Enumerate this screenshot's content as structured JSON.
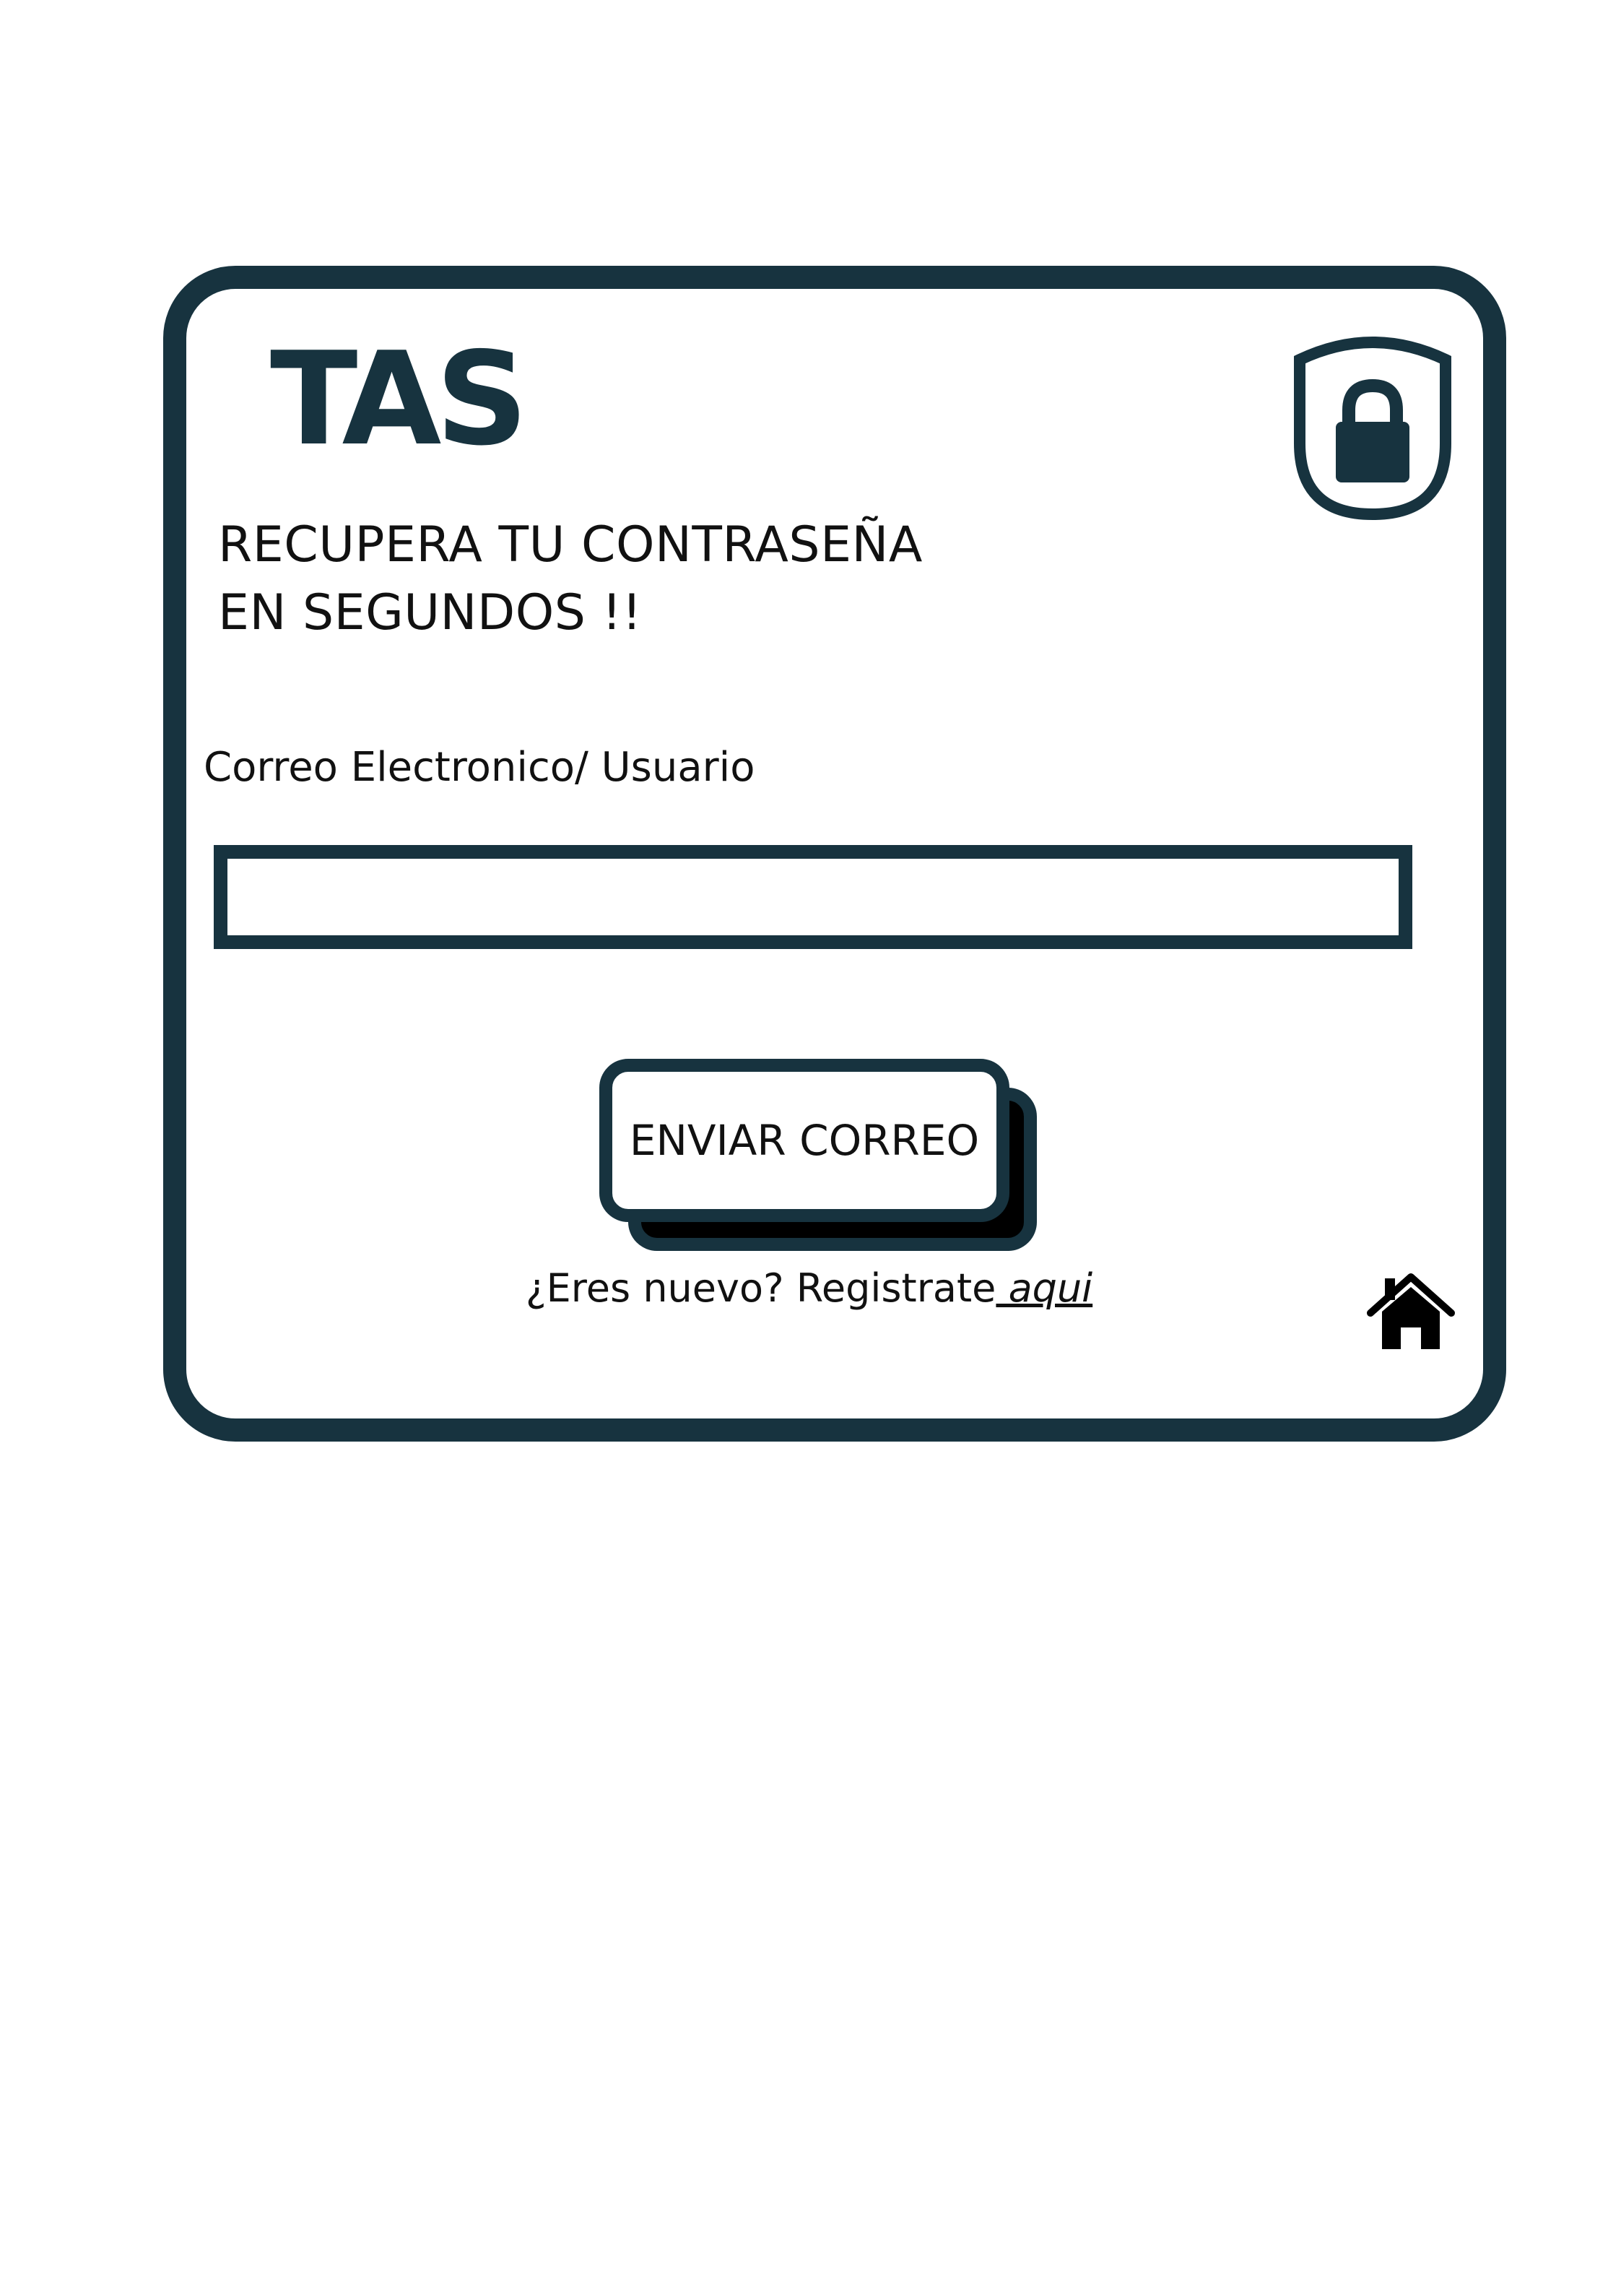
{
  "brand": {
    "logo_text": "TAS"
  },
  "heading": {
    "line1": "RECUPERA TU CONTRASEÑA",
    "line2": "EN SEGUNDOS !!"
  },
  "form": {
    "email_label": "Correo Electronico/ Usuario",
    "email_value": "",
    "submit_label": "ENVIAR CORREO"
  },
  "register": {
    "prompt": "¿Eres nuevo?  Registrate",
    "link_label": " aqui"
  },
  "icons": {
    "lock": "lock-shield-icon",
    "home": "home-icon"
  },
  "colors": {
    "accent": "#17333f",
    "text": "#111111",
    "background": "#ffffff"
  }
}
